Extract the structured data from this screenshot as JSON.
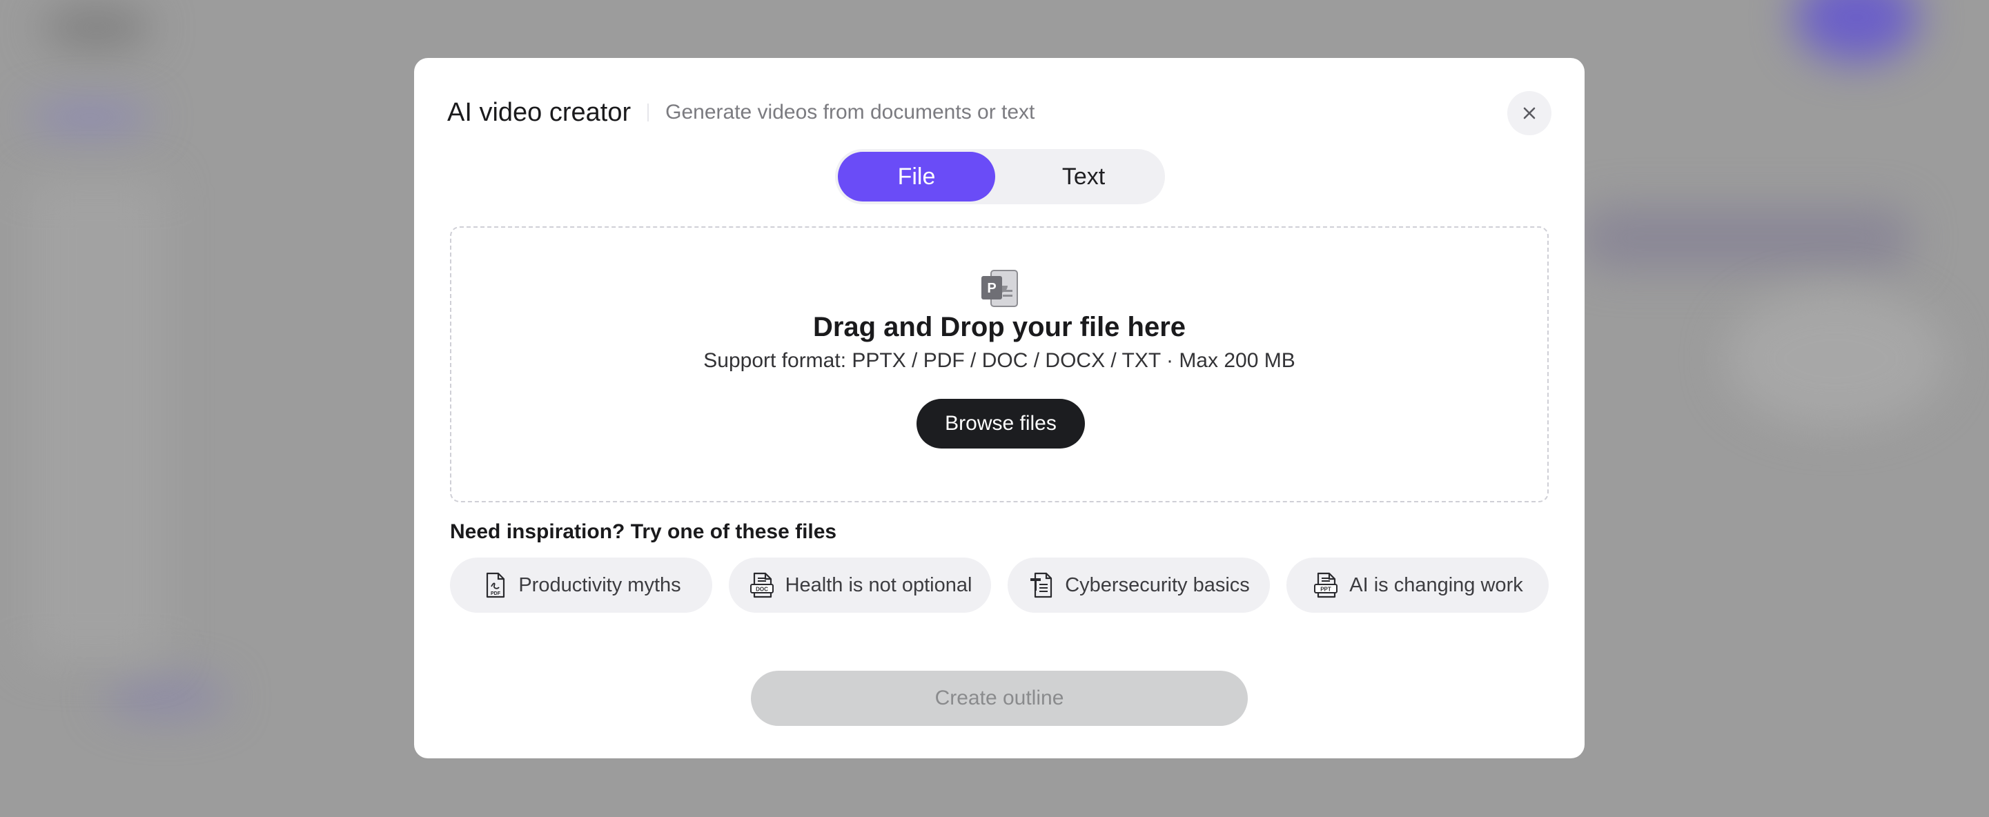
{
  "modal": {
    "title": "AI video creator",
    "subtitle": "Generate videos from documents or text",
    "close_icon": "close-icon"
  },
  "tabs": [
    {
      "label": "File",
      "selected": true
    },
    {
      "label": "Text",
      "selected": false
    }
  ],
  "dropzone": {
    "icon": "powerpoint-file-icon",
    "title": "Drag and Drop your file here",
    "support": "Support format: PPTX / PDF / DOC / DOCX / TXT · Max 200 MB",
    "browse_label": "Browse files"
  },
  "inspiration": {
    "heading": "Need inspiration? Try one of these files",
    "chips": [
      {
        "label": "Productivity myths",
        "icon": "pdf-file-icon"
      },
      {
        "label": "Health is not optional",
        "icon": "doc-file-icon"
      },
      {
        "label": "Cybersecurity basics",
        "icon": "text-file-icon"
      },
      {
        "label": "AI is changing work",
        "icon": "ppt-file-icon"
      }
    ]
  },
  "create_label": "Create outline",
  "colors": {
    "accent": "#6a4cf7",
    "primary_button": "#1c1d20",
    "disabled_button": "#d0d1d2",
    "overlay": "#9c9c9c"
  }
}
